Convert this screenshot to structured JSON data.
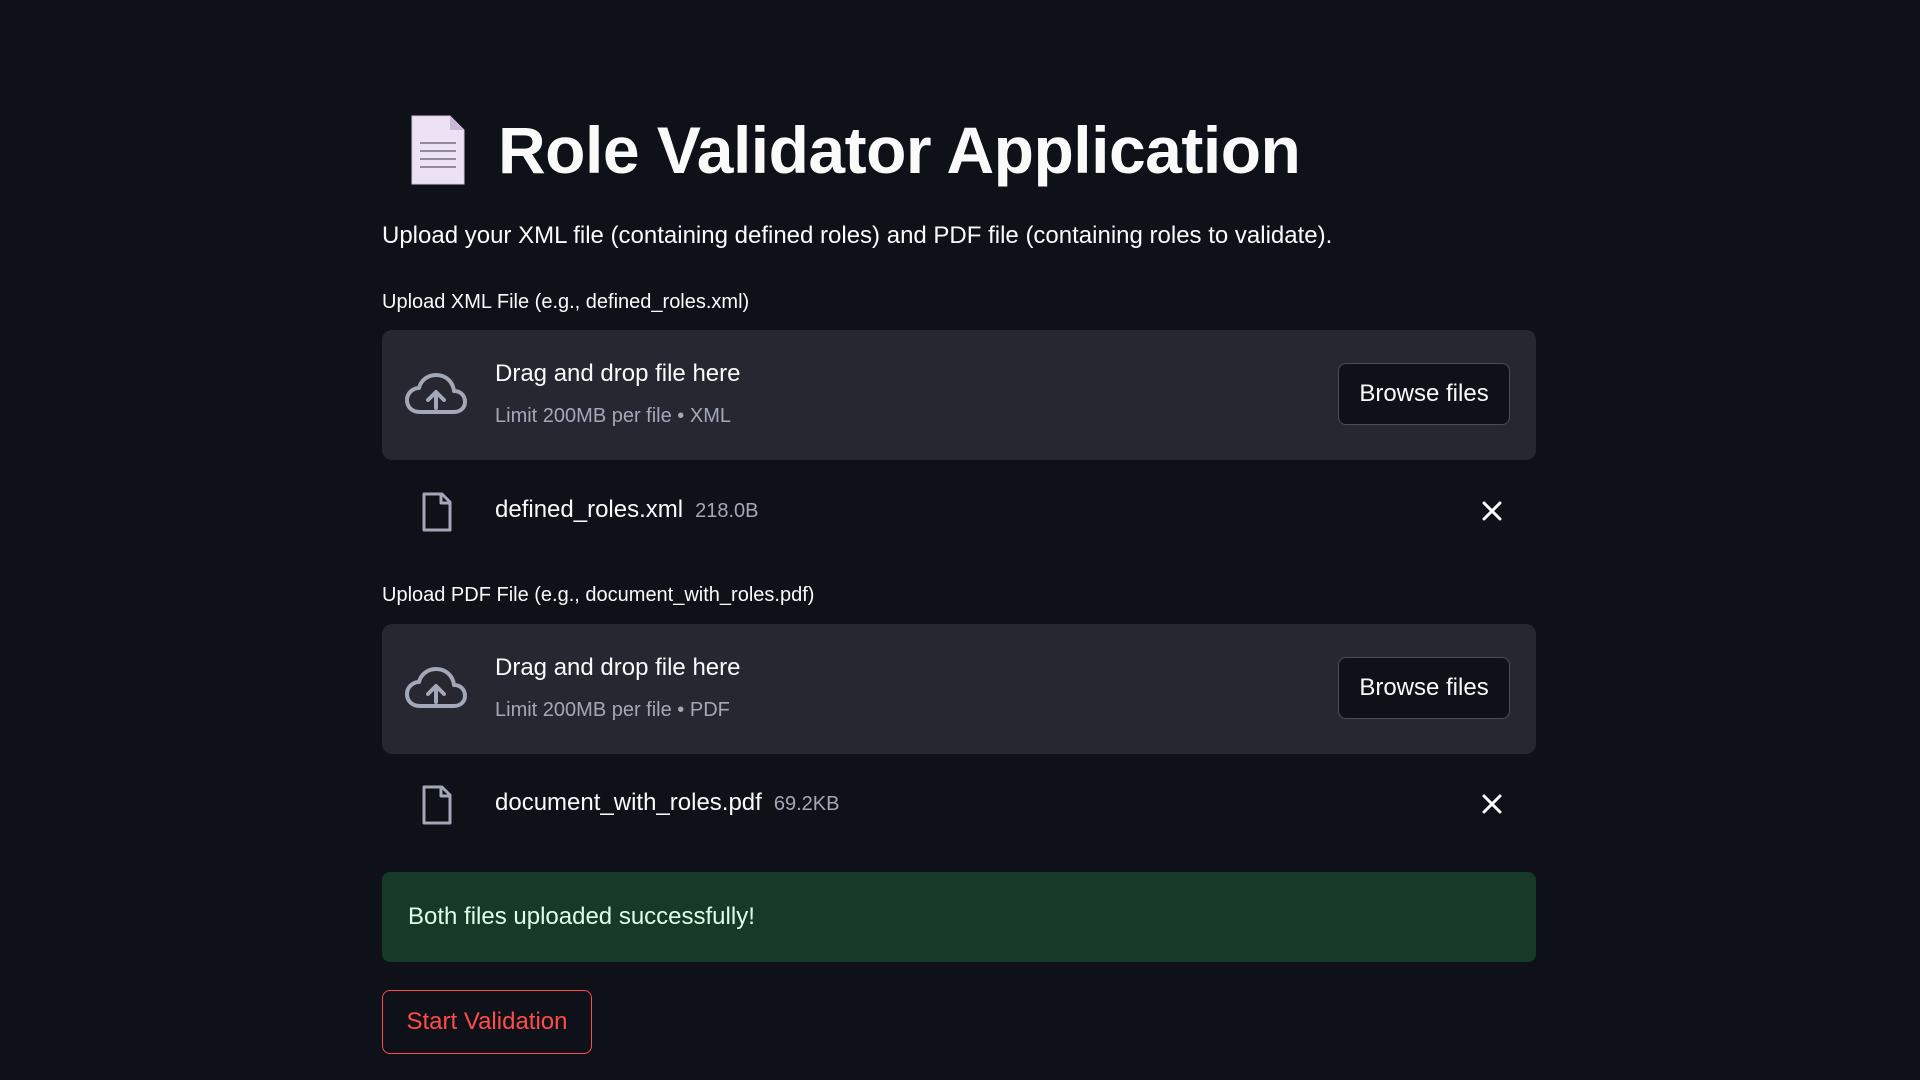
{
  "header": {
    "title": "Role Validator Application",
    "icon": "page-facing-up-icon"
  },
  "subtitle": "Upload your XML file (containing defined roles) and PDF file (containing roles to validate).",
  "uploaders": [
    {
      "label": "Upload XML File (e.g., defined_roles.xml)",
      "drop_text": "Drag and drop file here",
      "limit_text": "Limit 200MB per file • XML",
      "browse_label": "Browse files",
      "file": {
        "name": "defined_roles.xml",
        "size": "218.0B"
      }
    },
    {
      "label": "Upload PDF File (e.g., document_with_roles.pdf)",
      "drop_text": "Drag and drop file here",
      "limit_text": "Limit 200MB per file • PDF",
      "browse_label": "Browse files",
      "file": {
        "name": "document_with_roles.pdf",
        "size": "69.2KB"
      }
    }
  ],
  "status": {
    "message": "Both files uploaded successfully!"
  },
  "actions": {
    "start_label": "Start Validation"
  },
  "colors": {
    "background": "#0e1117",
    "dropzone": "#262730",
    "success_bg": "#173928",
    "accent": "#ff4b4b"
  }
}
